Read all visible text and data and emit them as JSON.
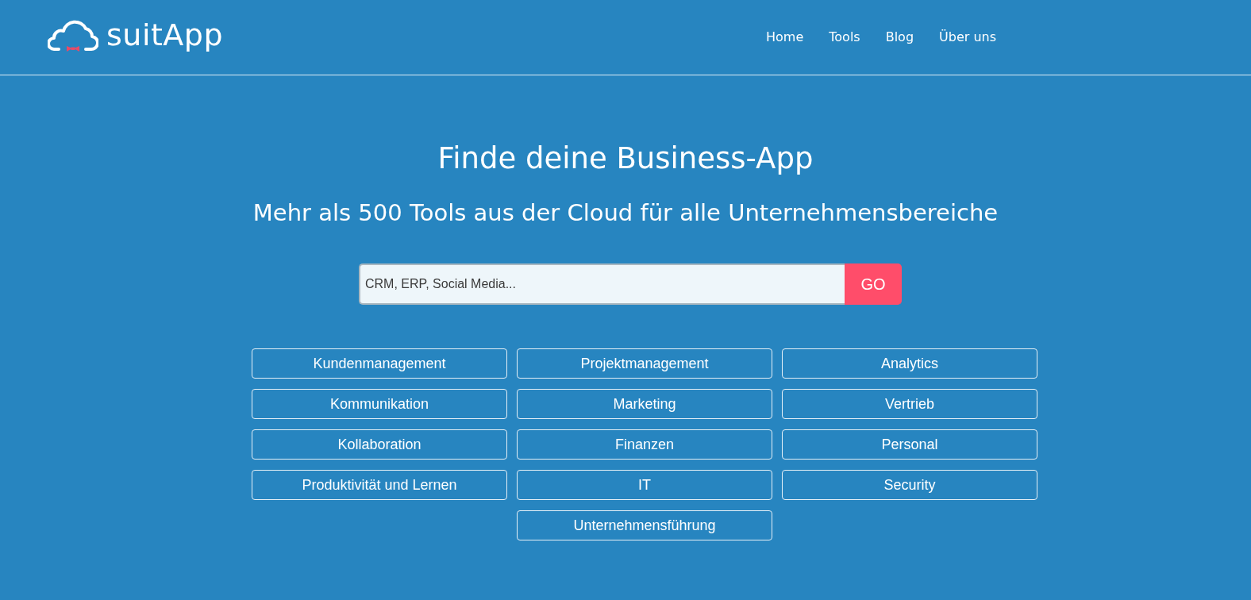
{
  "header": {
    "logo_text": "suitApp",
    "nav": [
      "Home",
      "Tools",
      "Blog",
      "Über uns"
    ]
  },
  "hero": {
    "title": "Finde deine Business-App",
    "subtitle": "Mehr als 500 Tools aus der Cloud für alle Unternehmensbereiche"
  },
  "search": {
    "placeholder": "CRM, ERP, Social Media...",
    "button": "GO"
  },
  "categories": [
    "Kundenmanagement",
    "Projektmanagement",
    "Analytics",
    "Kommunikation",
    "Marketing",
    "Vertrieb",
    "Kollaboration",
    "Finanzen",
    "Personal",
    "Produktivität und Lernen",
    "IT",
    "Security",
    "Unternehmensführung"
  ]
}
